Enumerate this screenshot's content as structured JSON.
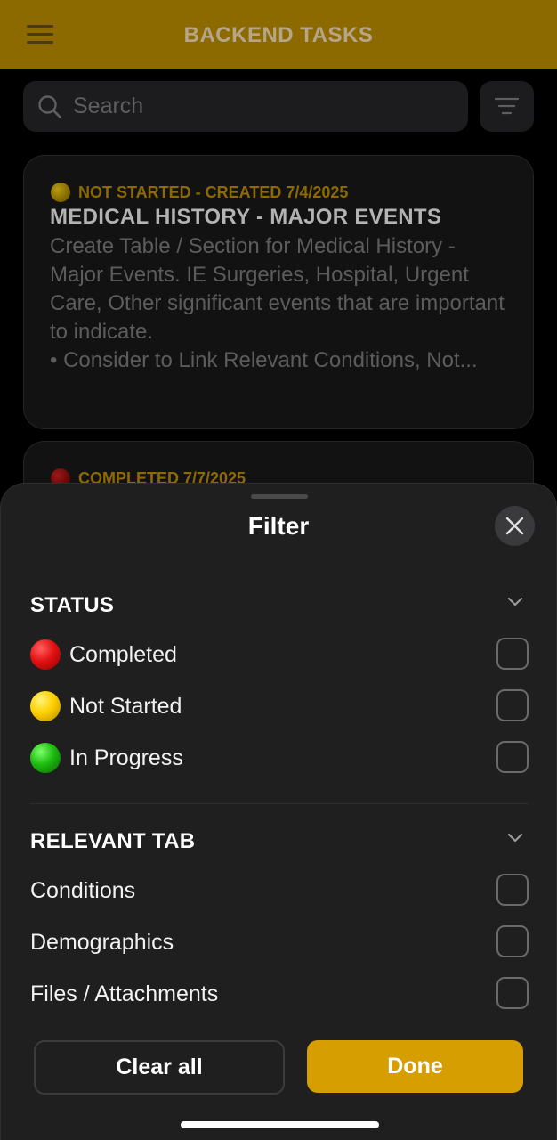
{
  "header": {
    "title": "BACKEND TASKS"
  },
  "search": {
    "placeholder": "Search"
  },
  "tasks": [
    {
      "status": "NOT STARTED - CREATED 7/4/2025",
      "title": "MEDICAL HISTORY - MAJOR EVENTS",
      "description": "Create Table / Section for Medical History - Major Events. IE Surgeries, Hospital, Urgent Care, Other significant events that are important to indicate.\n• Consider to Link Relevant Conditions, Not..."
    },
    {
      "status": "COMPLETED 7/7/2025"
    }
  ],
  "filter": {
    "title": "Filter",
    "status_section": {
      "title": "STATUS",
      "options": [
        {
          "label": "Completed",
          "checked": false
        },
        {
          "label": "Not Started",
          "checked": false
        },
        {
          "label": "In Progress",
          "checked": false
        }
      ]
    },
    "tab_section": {
      "title": "RELEVANT TAB",
      "options": [
        {
          "label": "Conditions",
          "checked": false
        },
        {
          "label": "Demographics",
          "checked": false
        },
        {
          "label": "Files / Attachments",
          "checked": false
        }
      ]
    },
    "clear_label": "Clear all",
    "done_label": "Done"
  },
  "colors": {
    "header_bg": "#8c6a00",
    "accent": "#d69e00",
    "completed": "#e31212",
    "not_started": "#ffd000",
    "in_progress": "#1dbb10"
  }
}
